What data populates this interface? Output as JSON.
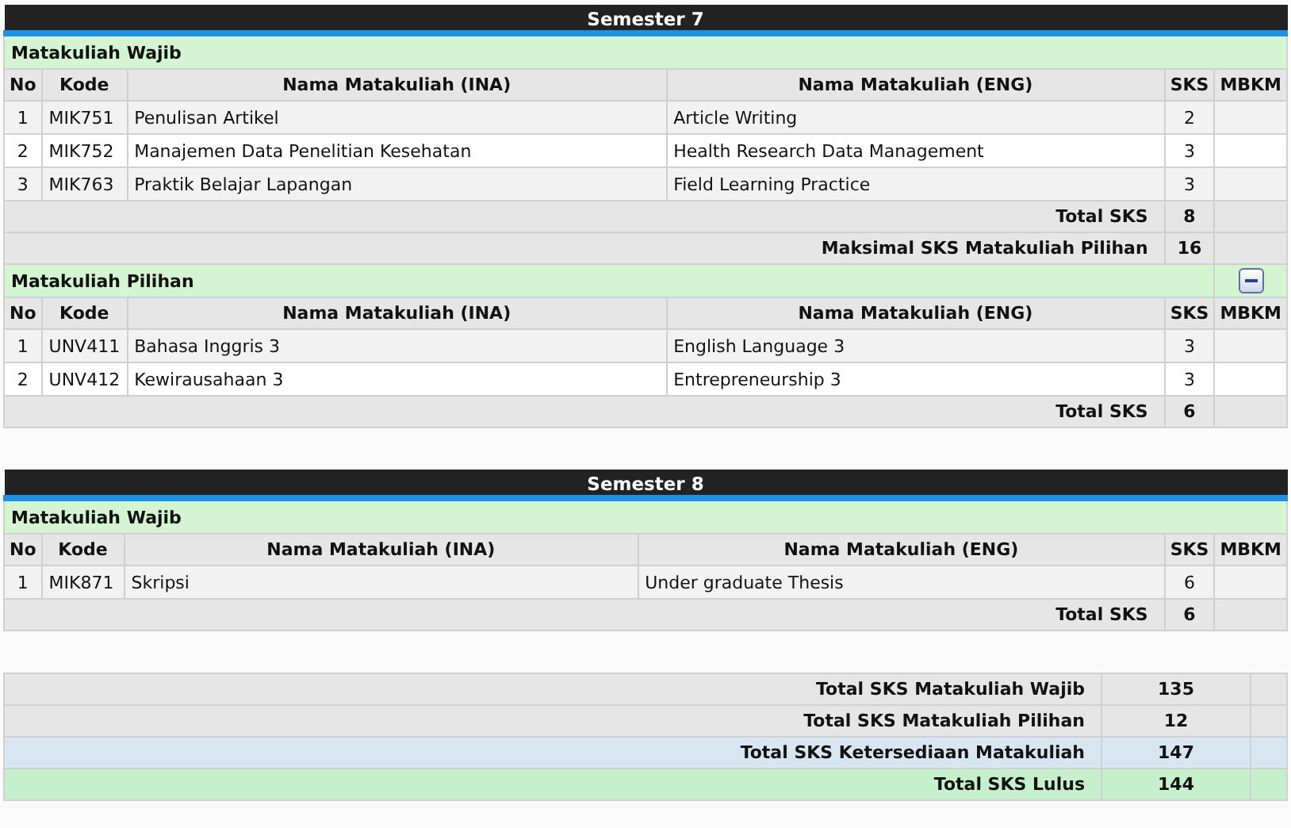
{
  "semesters": [
    {
      "title": "Semester 7",
      "sections": [
        {
          "title": "Matakuliah Wajib",
          "columns": [
            "No",
            "Kode",
            "Nama Matakuliah (INA)",
            "Nama Matakuliah (ENG)",
            "SKS",
            "MBKM"
          ],
          "rows": [
            {
              "no": "1",
              "code": "MIK751",
              "name_ina": "Penulisan Artikel",
              "name_eng": "Article Writing",
              "sks": "2"
            },
            {
              "no": "2",
              "code": "MIK752",
              "name_ina": "Manajemen Data Penelitian Kesehatan",
              "name_eng": "Health Research Data Management",
              "sks": "3"
            },
            {
              "no": "3",
              "code": "MIK763",
              "name_ina": "Praktik Belajar Lapangan",
              "name_eng": "Field Learning Practice",
              "sks": "3"
            }
          ],
          "totals": [
            {
              "label": "Total SKS",
              "value": "8"
            },
            {
              "label": "Maksimal SKS Matakuliah Pilihan",
              "value": "16"
            }
          ]
        },
        {
          "title": "Matakuliah Pilihan",
          "expanded": true,
          "columns": [
            "No",
            "Kode",
            "Nama Matakuliah (INA)",
            "Nama Matakuliah (ENG)",
            "SKS",
            "MBKM"
          ],
          "rows": [
            {
              "no": "1",
              "code": "UNV411",
              "name_ina": "Bahasa Inggris 3",
              "name_eng": "English Language 3",
              "sks": "3"
            },
            {
              "no": "2",
              "code": "UNV412",
              "name_ina": "Kewirausahaan 3",
              "name_eng": "Entrepreneurship 3",
              "sks": "3"
            }
          ],
          "totals": [
            {
              "label": "Total SKS",
              "value": "6"
            }
          ]
        }
      ]
    },
    {
      "title": "Semester 8",
      "sections": [
        {
          "title": "Matakuliah Wajib",
          "columns": [
            "No",
            "Kode",
            "Nama Matakuliah (INA)",
            "Nama Matakuliah (ENG)",
            "SKS",
            "MBKM"
          ],
          "rows": [
            {
              "no": "1",
              "code": "MIK871",
              "name_ina": "Skripsi",
              "name_eng": "Under graduate Thesis",
              "sks": "6"
            }
          ],
          "totals": [
            {
              "label": "Total SKS",
              "value": "6"
            }
          ]
        }
      ]
    }
  ],
  "summary": [
    {
      "kind": "plain",
      "label": "Total SKS Matakuliah Wajib",
      "value": "135"
    },
    {
      "kind": "plain",
      "label": "Total SKS Matakuliah Pilihan",
      "value": "12"
    },
    {
      "kind": "available",
      "label": "Total SKS Ketersediaan Matakuliah",
      "value": "147"
    },
    {
      "kind": "passed",
      "label": "Total SKS Lulus",
      "value": "144"
    }
  ]
}
